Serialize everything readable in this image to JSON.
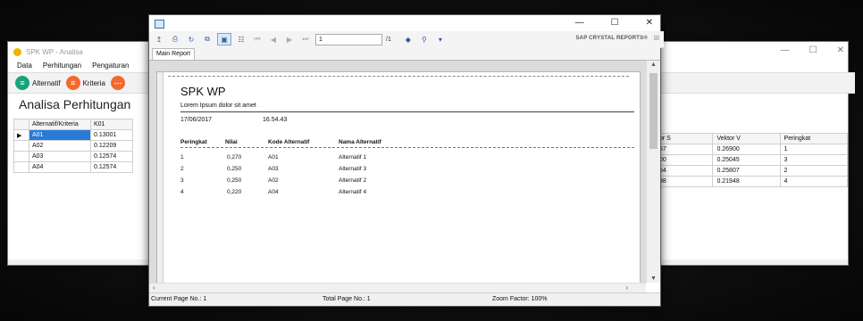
{
  "back_window": {
    "title": "SPK WP - Analisa",
    "menu": [
      "Data",
      "Perhitungan",
      "Pengaturan"
    ],
    "toolbar": {
      "alternatif_label": "Alternatif",
      "kriteria_label": "Kriteria"
    },
    "heading": "Analisa Perhitungan",
    "left_grid": {
      "columns": [
        "Alternatif/Kriteria",
        "K01"
      ],
      "rows": [
        [
          "A01",
          "0.13001"
        ],
        [
          "A02",
          "0.12209"
        ],
        [
          "A03",
          "0.12574"
        ],
        [
          "A04",
          "0.12574"
        ]
      ]
    },
    "right_grid": {
      "columns": [
        "or S",
        "Vektor V",
        "Peringkat"
      ],
      "rows": [
        [
          "57",
          "0.26900",
          "1"
        ],
        [
          "00",
          "0.25045",
          "3"
        ],
        [
          "54",
          "0.25807",
          "2"
        ],
        [
          "98",
          "0.21948",
          "4"
        ]
      ]
    },
    "accent_colors": {
      "green": "#1aa37a",
      "orange": "#f26a2e",
      "selected": "#2a7bd6"
    }
  },
  "report_window": {
    "page_input": "1",
    "page_total": "/1",
    "brand": "SAP CRYSTAL REPORTS®",
    "tab": "Main Report",
    "report": {
      "title": "SPK WP",
      "subtitle": "Lorem Ipsum dolor sit amet",
      "date": "17/06/2017",
      "time": "16.54.43",
      "headers": {
        "peringkat": "Peringkat",
        "nilai": "Nilai",
        "kode": "Kode Alternatif",
        "nama": "Nama Alternatif"
      },
      "rows": [
        {
          "peringkat": "1",
          "nilai": "0,270",
          "kode": "A01",
          "nama": "Alternatif 1"
        },
        {
          "peringkat": "2",
          "nilai": "0,250",
          "kode": "A03",
          "nama": "Alternatif 3"
        },
        {
          "peringkat": "3",
          "nilai": "0,250",
          "kode": "A02",
          "nama": "Alternatif 2"
        },
        {
          "peringkat": "4",
          "nilai": "0,220",
          "kode": "A04",
          "nama": "Alternatif 4"
        }
      ]
    },
    "status": {
      "current_page": "Current Page No.: 1",
      "total_page": "Total Page No.: 1",
      "zoom": "Zoom Factor: 100%"
    }
  }
}
